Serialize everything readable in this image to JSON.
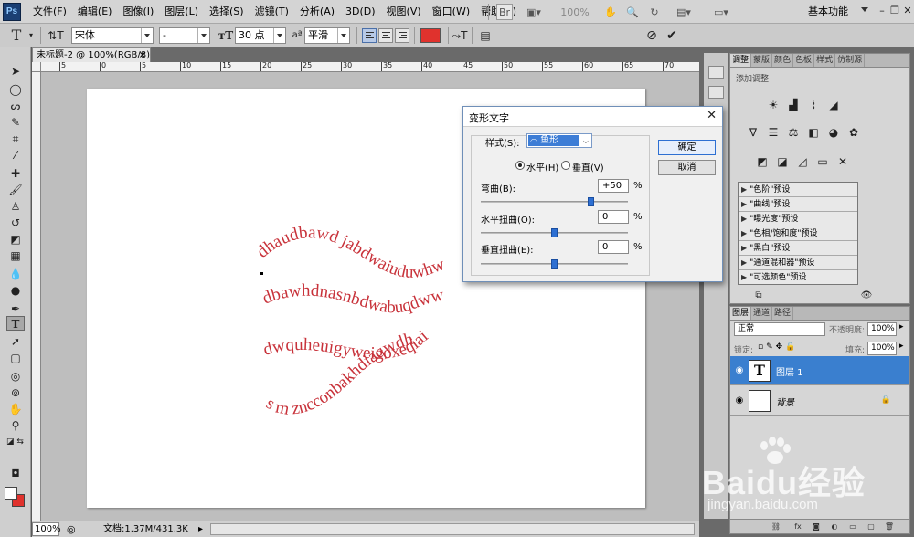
{
  "app": {
    "logo": "Ps",
    "menu": [
      "文件(F)",
      "编辑(E)",
      "图像(I)",
      "图层(L)",
      "选择(S)",
      "滤镜(T)",
      "分析(A)",
      "3D(D)",
      "视图(V)",
      "窗口(W)",
      "帮助(H)"
    ],
    "zoom_readout": "100%",
    "workspace": "基本功能"
  },
  "options": {
    "font_family": "宋体",
    "font_style": "-",
    "font_size": "30 点",
    "aa_label": "a",
    "aa_mode": "平滑",
    "text_color": "#e0322d"
  },
  "document": {
    "tab_title": "未标题-2 @ 100%(RGB/8)",
    "tab_close": "×",
    "ruler_ticks": [
      "5",
      "0",
      "5",
      "10",
      "15",
      "20",
      "25",
      "30",
      "35",
      "40",
      "45",
      "50",
      "55",
      "60",
      "65",
      "70",
      "75"
    ],
    "warped_lines": [
      "dhaudbawd jabdwaiuduwhw",
      "dbawhdnasnbdwabuqdwwh",
      "dwquheuigyweigoxeqiai",
      "s m zncconbakhdiaqwdh"
    ],
    "text_color": "#c8323a"
  },
  "status": {
    "zoom": "100%",
    "doc_size": "文档:1.37M/431.3K"
  },
  "warp_dialog": {
    "title": "变形文字",
    "style_label": "样式(S):",
    "style_value": "鱼形",
    "horizontal": "水平(H)",
    "vertical": "垂直(V)",
    "orientation": "horizontal",
    "bend_label": "弯曲(B):",
    "bend_value": "+50",
    "bend_amount": 50,
    "hdist_label": "水平扭曲(O):",
    "hdist_value": "0",
    "hdist_amount": 0,
    "vdist_label": "垂直扭曲(E):",
    "vdist_value": "0",
    "vdist_amount": 0,
    "percent": "%",
    "ok": "确定",
    "cancel": "取消"
  },
  "adjustments": {
    "tabs": [
      "调整",
      "蒙版",
      "颜色",
      "色板",
      "样式",
      "仿制源"
    ],
    "hint": "添加调整",
    "presets": [
      "\"色阶\"预设",
      "\"曲线\"预设",
      "\"曝光度\"预设",
      "\"色相/饱和度\"预设",
      "\"黑白\"预设",
      "\"通道混和器\"预设",
      "\"可选颜色\"预设"
    ]
  },
  "layers": {
    "tabs": [
      "图层",
      "通道",
      "路径"
    ],
    "blend_mode": "正常",
    "opacity_label": "不透明度:",
    "opacity": "100%",
    "lock_label": "锁定:",
    "fill_label": "填充:",
    "fill": "100%",
    "items": [
      {
        "name": "图层 1",
        "thumb": "T",
        "selected": true
      },
      {
        "name": "背景",
        "thumb": "",
        "selected": false
      }
    ]
  },
  "watermark": {
    "text": "Baidu经验",
    "url": "jingyan.baidu.com"
  }
}
